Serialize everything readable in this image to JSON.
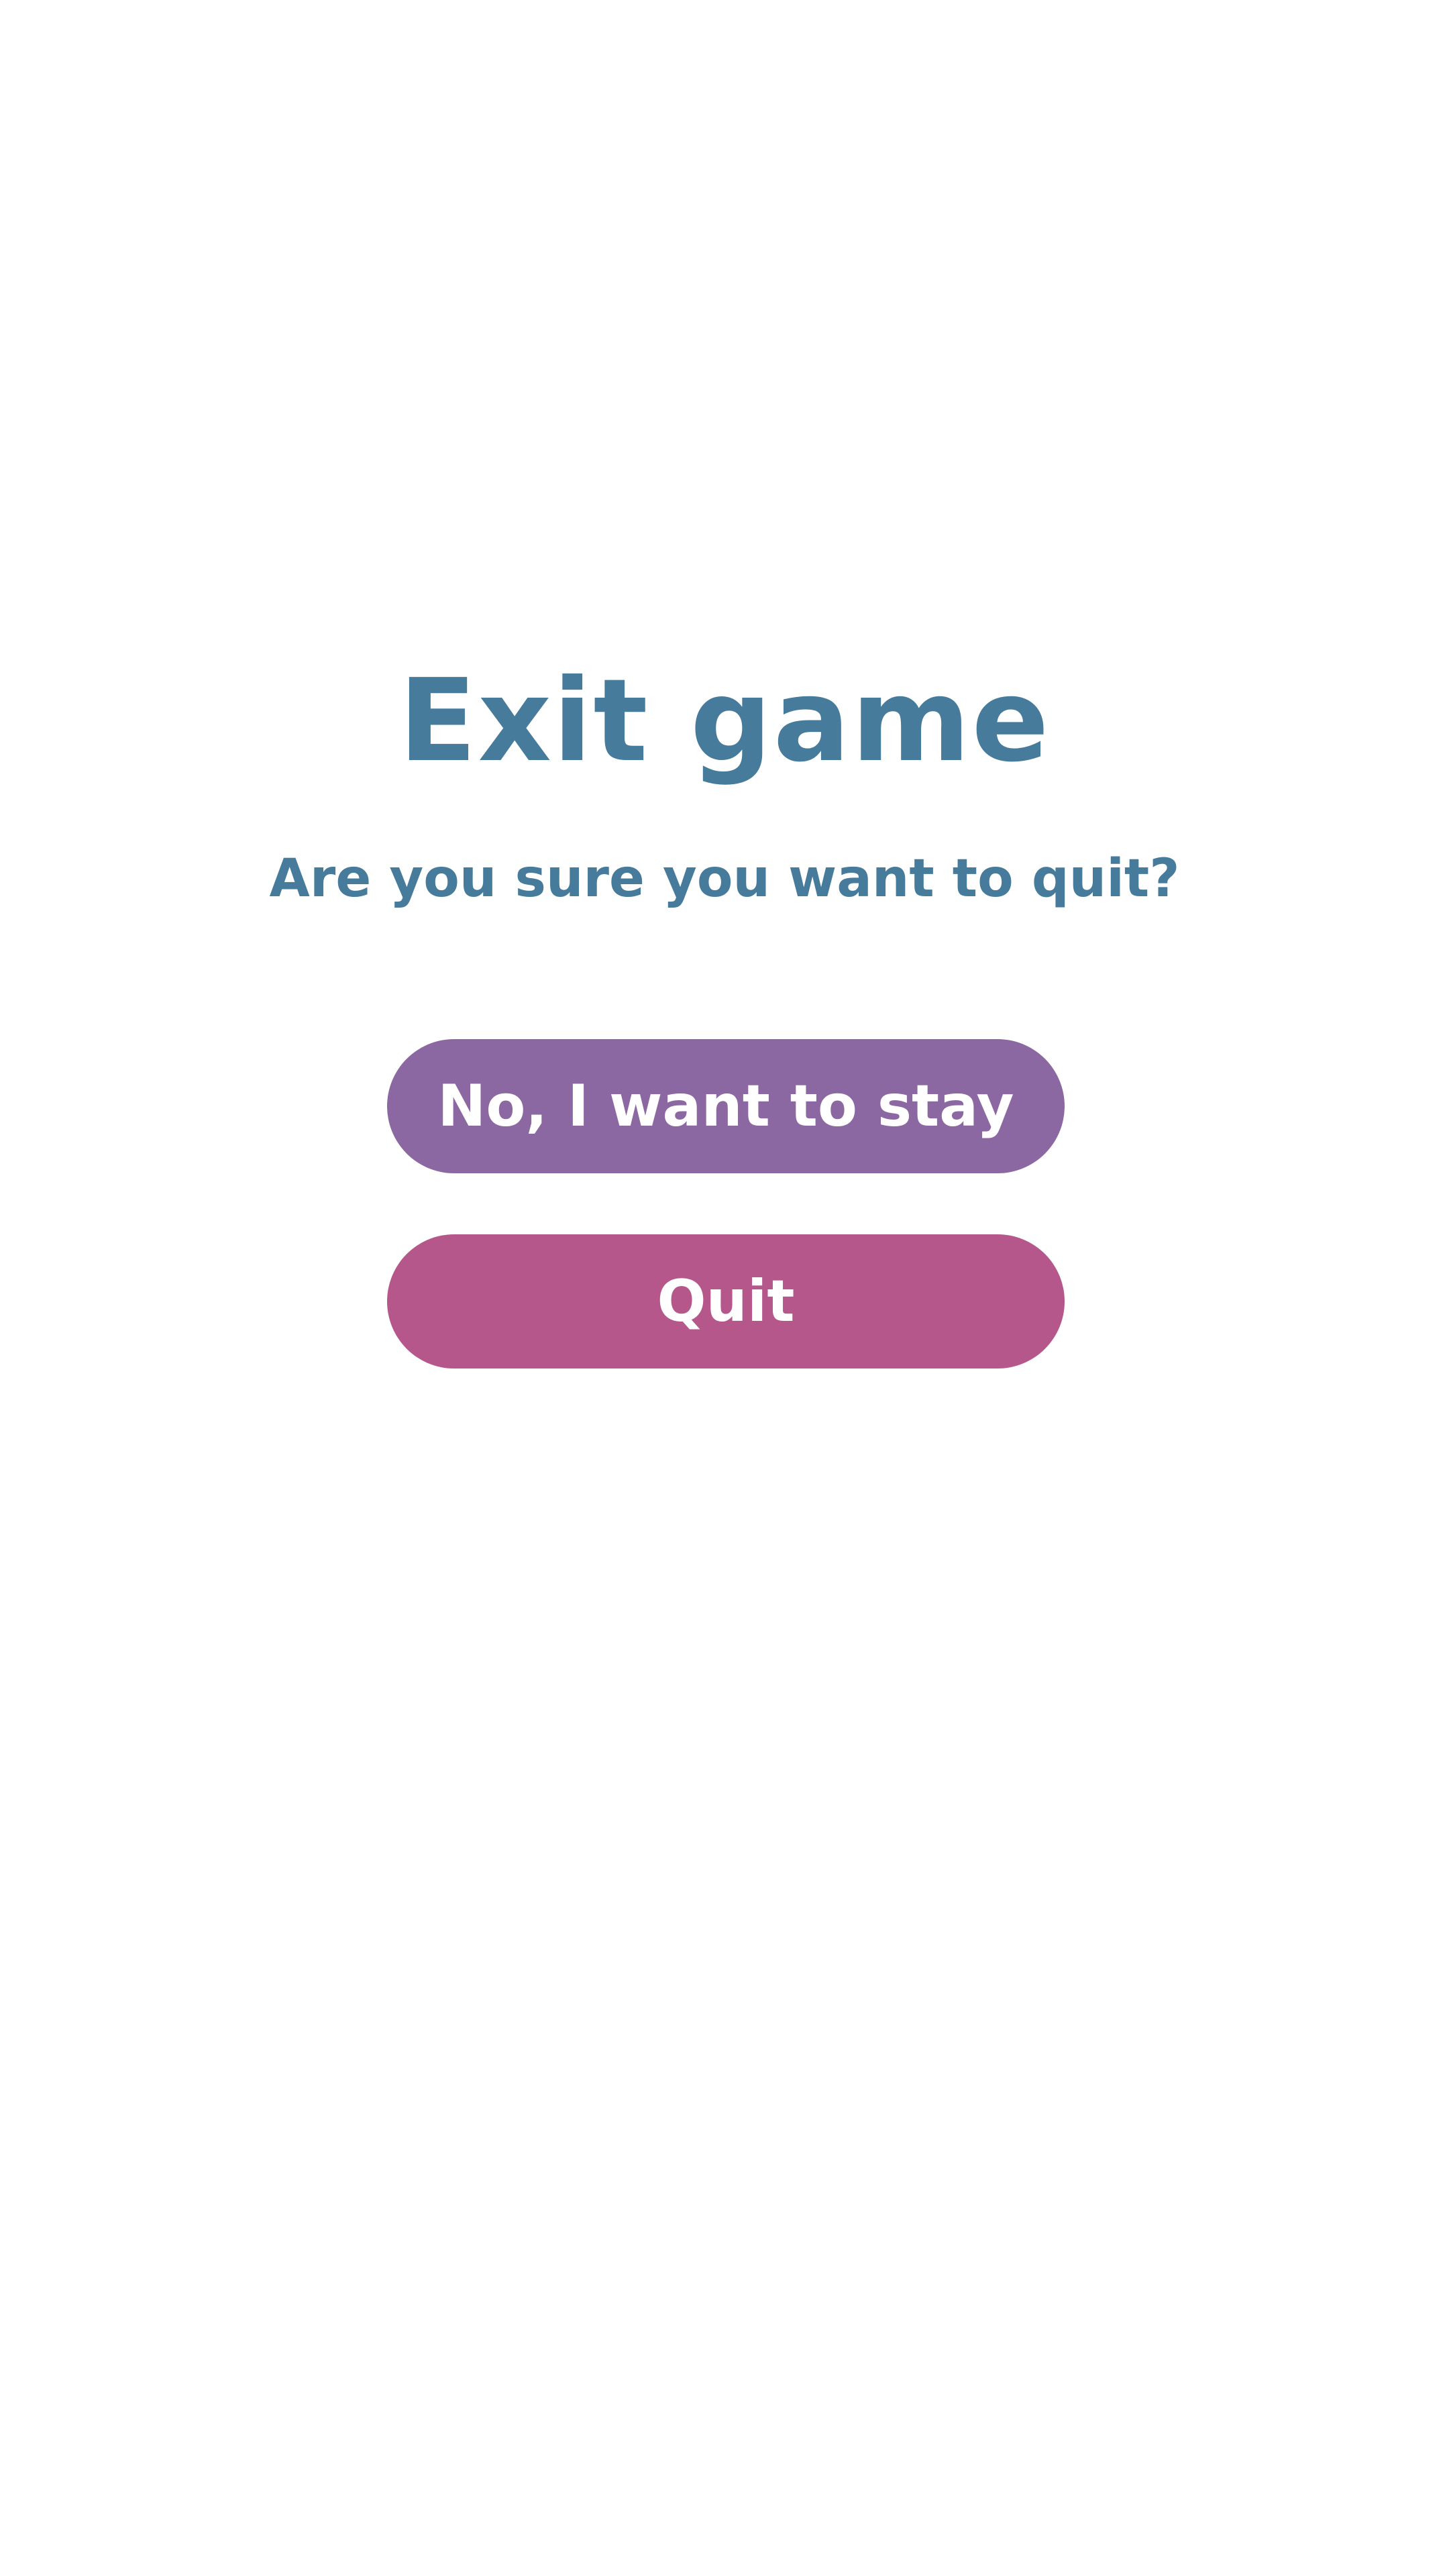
{
  "dialog": {
    "title": "Exit game",
    "message": "Are you sure you want to quit?",
    "stay_label": "No, I want to stay",
    "quit_label": "Quit"
  },
  "colors": {
    "background": "#ffffff",
    "text": "#467b9b",
    "stay_button": "#8c68a2",
    "quit_button": "#b5578a",
    "button_text": "#ffffff"
  }
}
